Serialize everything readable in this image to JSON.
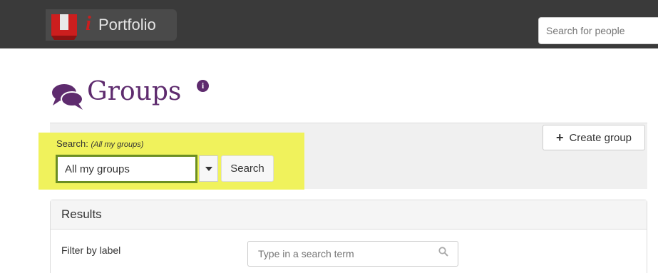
{
  "header": {
    "logo_text": "Portfolio",
    "logo_i": "i",
    "people_search_placeholder": "Search for people"
  },
  "page": {
    "title": "Groups",
    "info_icon": "i"
  },
  "search": {
    "label": "Search:",
    "hint": "(All my groups)",
    "selected_value": "All my groups",
    "button_label": "Search"
  },
  "create_group": {
    "label": "Create group"
  },
  "results": {
    "title": "Results",
    "filter_label": "Filter by label",
    "filter_placeholder": "Type in a search term"
  },
  "colors": {
    "header_bg": "#3a3a3a",
    "brand_purple": "#5e2b6e",
    "highlight_yellow": "#f0f25c",
    "focus_green": "#6b8e23",
    "logo_red": "#cc1e1e"
  },
  "icons": {
    "title": "chat-bubbles-icon",
    "info": "info-icon",
    "create": "plus-icon",
    "filter": "search-icon",
    "dropdown": "caret-down-icon"
  }
}
